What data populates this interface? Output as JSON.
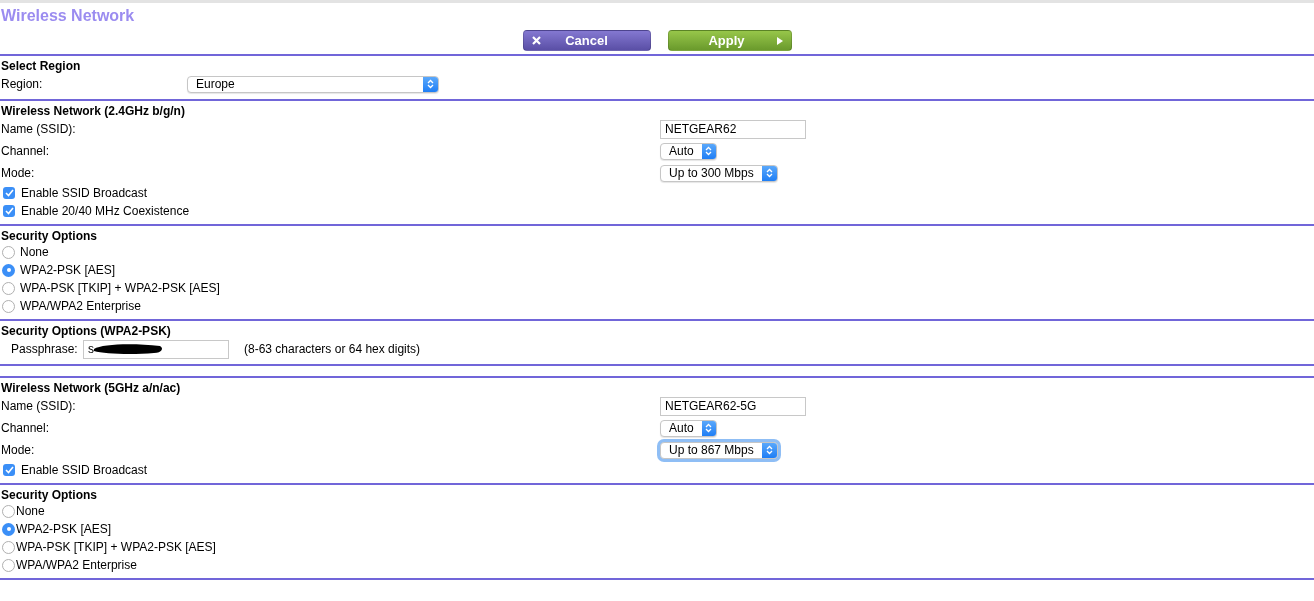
{
  "title": "Wireless Network",
  "buttons": [
    {
      "label": "Cancel",
      "kind": "cancel"
    },
    {
      "label": "Apply",
      "kind": "apply"
    }
  ],
  "sections": [
    {
      "kind": "region",
      "heading": "Select Region",
      "rows": [
        {
          "kind": "select",
          "label": "Region:",
          "value": "Europe",
          "focused": false
        }
      ]
    },
    {
      "kind": "network",
      "heading": "Wireless Network (2.4GHz b/g/n)",
      "rows": [
        {
          "kind": "text",
          "label": "Name (SSID):",
          "value": "NETGEAR62"
        },
        {
          "kind": "select",
          "label": "Channel:",
          "value": "Auto",
          "focused": false
        },
        {
          "kind": "select",
          "label": "Mode:",
          "value": "Up to 300 Mbps",
          "focused": false
        },
        {
          "kind": "checkbox",
          "label": "Enable SSID Broadcast",
          "checked": true
        },
        {
          "kind": "checkbox",
          "label": "Enable 20/40 MHz Coexistence",
          "checked": true
        }
      ]
    },
    {
      "kind": "network",
      "heading": "Security Options",
      "rows": [
        {
          "kind": "radio",
          "label": "None",
          "selected": false
        },
        {
          "kind": "radio",
          "label": "WPA2-PSK [AES]",
          "selected": true
        },
        {
          "kind": "radio",
          "label": "WPA-PSK [TKIP] + WPA2-PSK [AES]",
          "selected": false
        },
        {
          "kind": "radio",
          "label": "WPA/WPA2 Enterprise",
          "selected": false
        }
      ]
    },
    {
      "kind": "network",
      "heading": "Security Options (WPA2-PSK)",
      "rows": [
        {
          "kind": "passphrase",
          "label": "Passphrase:",
          "value": "s",
          "hint": "(8-63 characters or 64 hex digits)"
        }
      ]
    },
    {
      "kind": "spacer"
    },
    {
      "kind": "network",
      "heading": "Wireless Network (5GHz a/n/ac)",
      "rows": [
        {
          "kind": "text",
          "label": "Name (SSID):",
          "value": "NETGEAR62-5G"
        },
        {
          "kind": "select",
          "label": "Channel:",
          "value": "Auto",
          "focused": false
        },
        {
          "kind": "select",
          "label": "Mode:",
          "value": "Up to 867 Mbps",
          "focused": true
        },
        {
          "kind": "checkbox",
          "label": "Enable SSID Broadcast",
          "checked": true
        }
      ]
    },
    {
      "kind": "network",
      "heading": "Security Options",
      "rows": [
        {
          "kind": "radio",
          "label": "None",
          "selected": false
        },
        {
          "kind": "radio",
          "label": "WPA2-PSK [AES]",
          "selected": true
        },
        {
          "kind": "radio",
          "label": "WPA-PSK [TKIP] + WPA2-PSK [AES]",
          "selected": false
        },
        {
          "kind": "radio",
          "label": "WPA/WPA2 Enterprise",
          "selected": false
        }
      ]
    }
  ]
}
